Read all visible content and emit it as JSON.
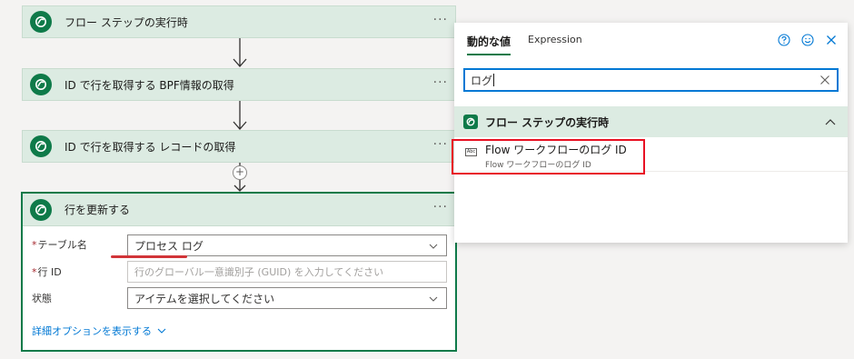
{
  "steps": [
    {
      "title": "フロー ステップの実行時"
    },
    {
      "title": "ID で行を取得する BPF情報の取得"
    },
    {
      "title": "ID で行を取得する レコードの取得"
    }
  ],
  "more": "···",
  "add_step": "+",
  "card": {
    "title": "行を更新する",
    "fields": [
      {
        "label": "テーブル名",
        "required": "*",
        "value": "プロセス ログ"
      },
      {
        "label": "行 ID",
        "required": "*",
        "placeholder": "行のグローバル一意識別子 (GUID) を入力してください"
      },
      {
        "label": "状態",
        "value": "アイテムを選択してください"
      }
    ],
    "advanced": "詳細オプションを表示する"
  },
  "popup": {
    "tabs": [
      "動的な値",
      "Expression"
    ],
    "search_value": "ログ",
    "section_title": "フロー ステップの実行時",
    "item": {
      "title": "Flow ワークフローのログ ID",
      "subtitle": "Flow ワークフローのログ ID",
      "badge": "Abc"
    }
  },
  "colors": {
    "brand": "#0e7a49",
    "accent": "#0078d4",
    "highlight": "#e81123"
  }
}
